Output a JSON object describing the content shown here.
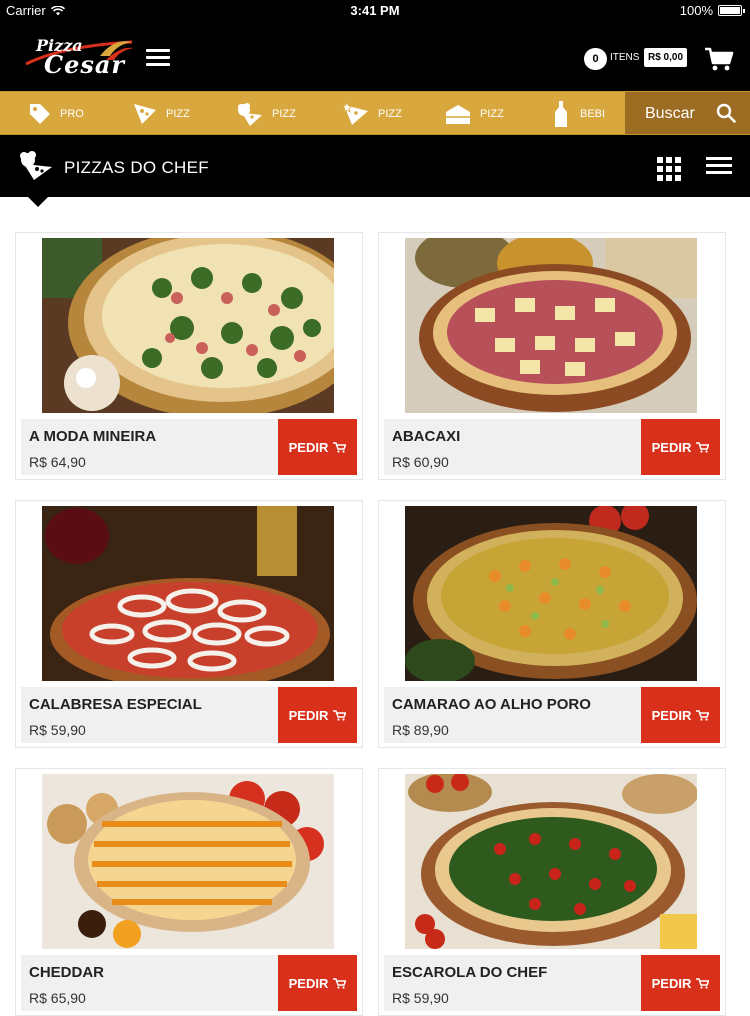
{
  "status_bar": {
    "carrier": "Carrier",
    "time": "3:41 PM",
    "battery": "100%"
  },
  "header": {
    "logo_line1": "Pizza",
    "logo_line2": "Cesar",
    "cart_count": "0",
    "cart_itens_label": "ITENS",
    "cart_total": "R$ 0,00"
  },
  "categories": [
    {
      "label": "PRO",
      "icon": "tag-icon"
    },
    {
      "label": "PIZZ",
      "icon": "pizza-slice-icon"
    },
    {
      "label": "PIZZ",
      "icon": "pizza-chef-icon"
    },
    {
      "label": "PIZZ",
      "icon": "pizza-star-icon"
    },
    {
      "label": "PIZZ",
      "icon": "cake-icon"
    },
    {
      "label": "BEBI",
      "icon": "bottle-icon"
    }
  ],
  "search": {
    "label": "Buscar"
  },
  "section": {
    "title": "PIZZAS DO CHEF"
  },
  "products": [
    {
      "name": "A MODA MINEIRA",
      "price": "R$ 64,90",
      "button": "PEDIR"
    },
    {
      "name": "ABACAXI",
      "price": "R$ 60,90",
      "button": "PEDIR"
    },
    {
      "name": "CALABRESA ESPECIAL",
      "price": "R$ 59,90",
      "button": "PEDIR"
    },
    {
      "name": "CAMARAO AO ALHO PORO",
      "price": "R$ 89,90",
      "button": "PEDIR"
    },
    {
      "name": "CHEDDAR",
      "price": "R$ 65,90",
      "button": "PEDIR"
    },
    {
      "name": "ESCAROLA DO CHEF",
      "price": "R$ 59,90",
      "button": "PEDIR"
    }
  ],
  "colors": {
    "accent_gold": "#d8a73e",
    "search_brown": "#9c6c22",
    "button_red": "#d9301c"
  }
}
